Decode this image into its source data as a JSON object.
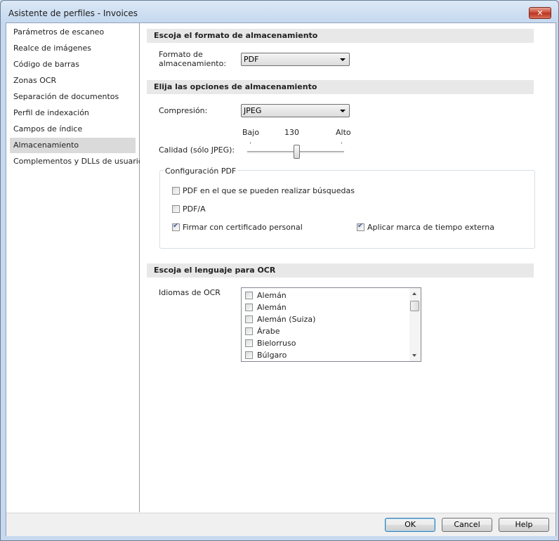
{
  "window": {
    "title": "Asistente de perfiles - Invoices",
    "close_glyph": "✕"
  },
  "sidebar": {
    "items": [
      {
        "label": "Parámetros de escaneo"
      },
      {
        "label": "Realce de imágenes"
      },
      {
        "label": "Código de barras"
      },
      {
        "label": "Zonas OCR"
      },
      {
        "label": "Separación de documentos"
      },
      {
        "label": "Perfil de indexación"
      },
      {
        "label": "Campos de índice"
      },
      {
        "label": "Almacenamiento",
        "selected": true
      },
      {
        "label": "Complementos y DLLs de usuario"
      }
    ]
  },
  "storage_format": {
    "heading": "Escoja el formato de almacenamiento",
    "format_label": "Formato de almacenamiento:",
    "format_value": "PDF"
  },
  "storage_options": {
    "heading": "Elija las opciones de almacenamiento",
    "compression_label": "Compresión:",
    "compression_value": "JPEG",
    "quality_low": "Bajo",
    "quality_value": "130",
    "quality_high": "Alto",
    "quality_label": "Calidad (sólo JPEG):",
    "quality_level": 130
  },
  "pdf_config": {
    "title": "Configuración PDF",
    "searchable_label": "PDF en el que se pueden realizar búsquedas",
    "searchable_checked": false,
    "pdfa_label": "PDF/A",
    "pdfa_checked": false,
    "sign_label": "Firmar con certificado personal",
    "sign_checked": true,
    "timestamp_label": "Aplicar marca de tiempo externa",
    "timestamp_checked": true
  },
  "ocr": {
    "heading": "Escoja el lenguaje para OCR",
    "languages_label": "Idiomas de OCR",
    "languages": [
      {
        "label": "Alemán",
        "checked": false
      },
      {
        "label": "Alemán",
        "checked": false
      },
      {
        "label": "Alemán (Suiza)",
        "checked": false
      },
      {
        "label": "Árabe",
        "checked": false
      },
      {
        "label": "Bielorruso",
        "checked": false
      },
      {
        "label": "Búlgaro",
        "checked": false
      }
    ]
  },
  "footer": {
    "ok_label": "OK",
    "cancel_label": "Cancel",
    "help_label": "Help"
  },
  "colors": {
    "selected_row": "#dadada",
    "section_header": "#e8e8e8",
    "close_button": "#c7432d",
    "check_mark": "#4c61a3"
  }
}
